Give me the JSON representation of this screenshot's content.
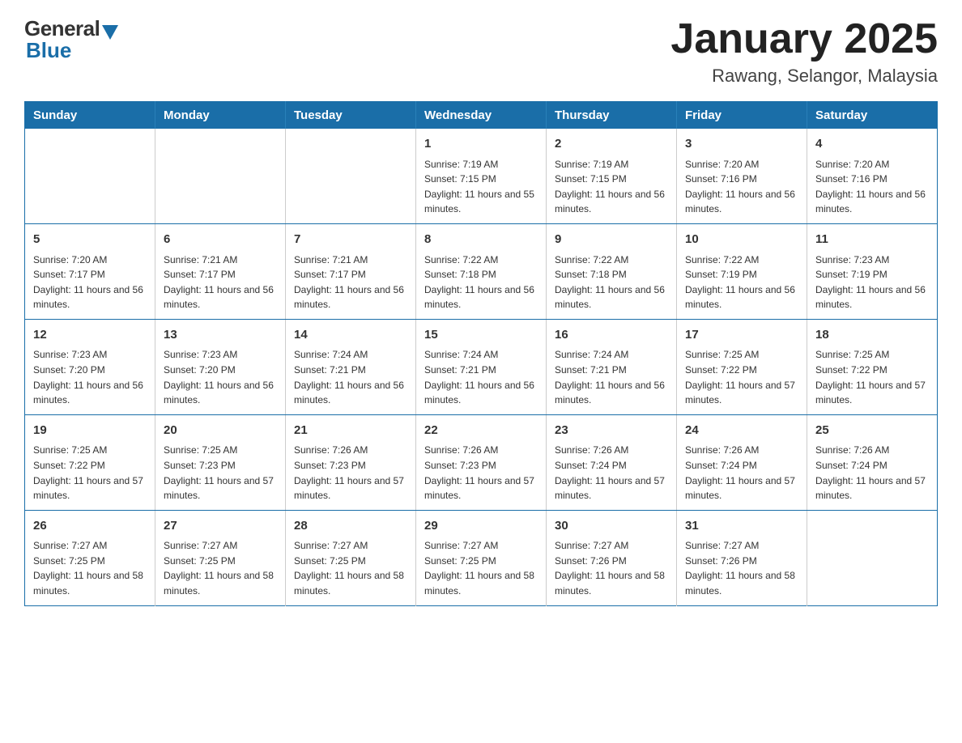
{
  "header": {
    "logo": {
      "general": "General",
      "blue": "Blue"
    },
    "title": "January 2025",
    "location": "Rawang, Selangor, Malaysia"
  },
  "calendar": {
    "days_of_week": [
      "Sunday",
      "Monday",
      "Tuesday",
      "Wednesday",
      "Thursday",
      "Friday",
      "Saturday"
    ],
    "weeks": [
      [
        {
          "day": "",
          "info": ""
        },
        {
          "day": "",
          "info": ""
        },
        {
          "day": "",
          "info": ""
        },
        {
          "day": "1",
          "info": "Sunrise: 7:19 AM\nSunset: 7:15 PM\nDaylight: 11 hours and 55 minutes."
        },
        {
          "day": "2",
          "info": "Sunrise: 7:19 AM\nSunset: 7:15 PM\nDaylight: 11 hours and 56 minutes."
        },
        {
          "day": "3",
          "info": "Sunrise: 7:20 AM\nSunset: 7:16 PM\nDaylight: 11 hours and 56 minutes."
        },
        {
          "day": "4",
          "info": "Sunrise: 7:20 AM\nSunset: 7:16 PM\nDaylight: 11 hours and 56 minutes."
        }
      ],
      [
        {
          "day": "5",
          "info": "Sunrise: 7:20 AM\nSunset: 7:17 PM\nDaylight: 11 hours and 56 minutes."
        },
        {
          "day": "6",
          "info": "Sunrise: 7:21 AM\nSunset: 7:17 PM\nDaylight: 11 hours and 56 minutes."
        },
        {
          "day": "7",
          "info": "Sunrise: 7:21 AM\nSunset: 7:17 PM\nDaylight: 11 hours and 56 minutes."
        },
        {
          "day": "8",
          "info": "Sunrise: 7:22 AM\nSunset: 7:18 PM\nDaylight: 11 hours and 56 minutes."
        },
        {
          "day": "9",
          "info": "Sunrise: 7:22 AM\nSunset: 7:18 PM\nDaylight: 11 hours and 56 minutes."
        },
        {
          "day": "10",
          "info": "Sunrise: 7:22 AM\nSunset: 7:19 PM\nDaylight: 11 hours and 56 minutes."
        },
        {
          "day": "11",
          "info": "Sunrise: 7:23 AM\nSunset: 7:19 PM\nDaylight: 11 hours and 56 minutes."
        }
      ],
      [
        {
          "day": "12",
          "info": "Sunrise: 7:23 AM\nSunset: 7:20 PM\nDaylight: 11 hours and 56 minutes."
        },
        {
          "day": "13",
          "info": "Sunrise: 7:23 AM\nSunset: 7:20 PM\nDaylight: 11 hours and 56 minutes."
        },
        {
          "day": "14",
          "info": "Sunrise: 7:24 AM\nSunset: 7:21 PM\nDaylight: 11 hours and 56 minutes."
        },
        {
          "day": "15",
          "info": "Sunrise: 7:24 AM\nSunset: 7:21 PM\nDaylight: 11 hours and 56 minutes."
        },
        {
          "day": "16",
          "info": "Sunrise: 7:24 AM\nSunset: 7:21 PM\nDaylight: 11 hours and 56 minutes."
        },
        {
          "day": "17",
          "info": "Sunrise: 7:25 AM\nSunset: 7:22 PM\nDaylight: 11 hours and 57 minutes."
        },
        {
          "day": "18",
          "info": "Sunrise: 7:25 AM\nSunset: 7:22 PM\nDaylight: 11 hours and 57 minutes."
        }
      ],
      [
        {
          "day": "19",
          "info": "Sunrise: 7:25 AM\nSunset: 7:22 PM\nDaylight: 11 hours and 57 minutes."
        },
        {
          "day": "20",
          "info": "Sunrise: 7:25 AM\nSunset: 7:23 PM\nDaylight: 11 hours and 57 minutes."
        },
        {
          "day": "21",
          "info": "Sunrise: 7:26 AM\nSunset: 7:23 PM\nDaylight: 11 hours and 57 minutes."
        },
        {
          "day": "22",
          "info": "Sunrise: 7:26 AM\nSunset: 7:23 PM\nDaylight: 11 hours and 57 minutes."
        },
        {
          "day": "23",
          "info": "Sunrise: 7:26 AM\nSunset: 7:24 PM\nDaylight: 11 hours and 57 minutes."
        },
        {
          "day": "24",
          "info": "Sunrise: 7:26 AM\nSunset: 7:24 PM\nDaylight: 11 hours and 57 minutes."
        },
        {
          "day": "25",
          "info": "Sunrise: 7:26 AM\nSunset: 7:24 PM\nDaylight: 11 hours and 57 minutes."
        }
      ],
      [
        {
          "day": "26",
          "info": "Sunrise: 7:27 AM\nSunset: 7:25 PM\nDaylight: 11 hours and 58 minutes."
        },
        {
          "day": "27",
          "info": "Sunrise: 7:27 AM\nSunset: 7:25 PM\nDaylight: 11 hours and 58 minutes."
        },
        {
          "day": "28",
          "info": "Sunrise: 7:27 AM\nSunset: 7:25 PM\nDaylight: 11 hours and 58 minutes."
        },
        {
          "day": "29",
          "info": "Sunrise: 7:27 AM\nSunset: 7:25 PM\nDaylight: 11 hours and 58 minutes."
        },
        {
          "day": "30",
          "info": "Sunrise: 7:27 AM\nSunset: 7:26 PM\nDaylight: 11 hours and 58 minutes."
        },
        {
          "day": "31",
          "info": "Sunrise: 7:27 AM\nSunset: 7:26 PM\nDaylight: 11 hours and 58 minutes."
        },
        {
          "day": "",
          "info": ""
        }
      ]
    ]
  }
}
